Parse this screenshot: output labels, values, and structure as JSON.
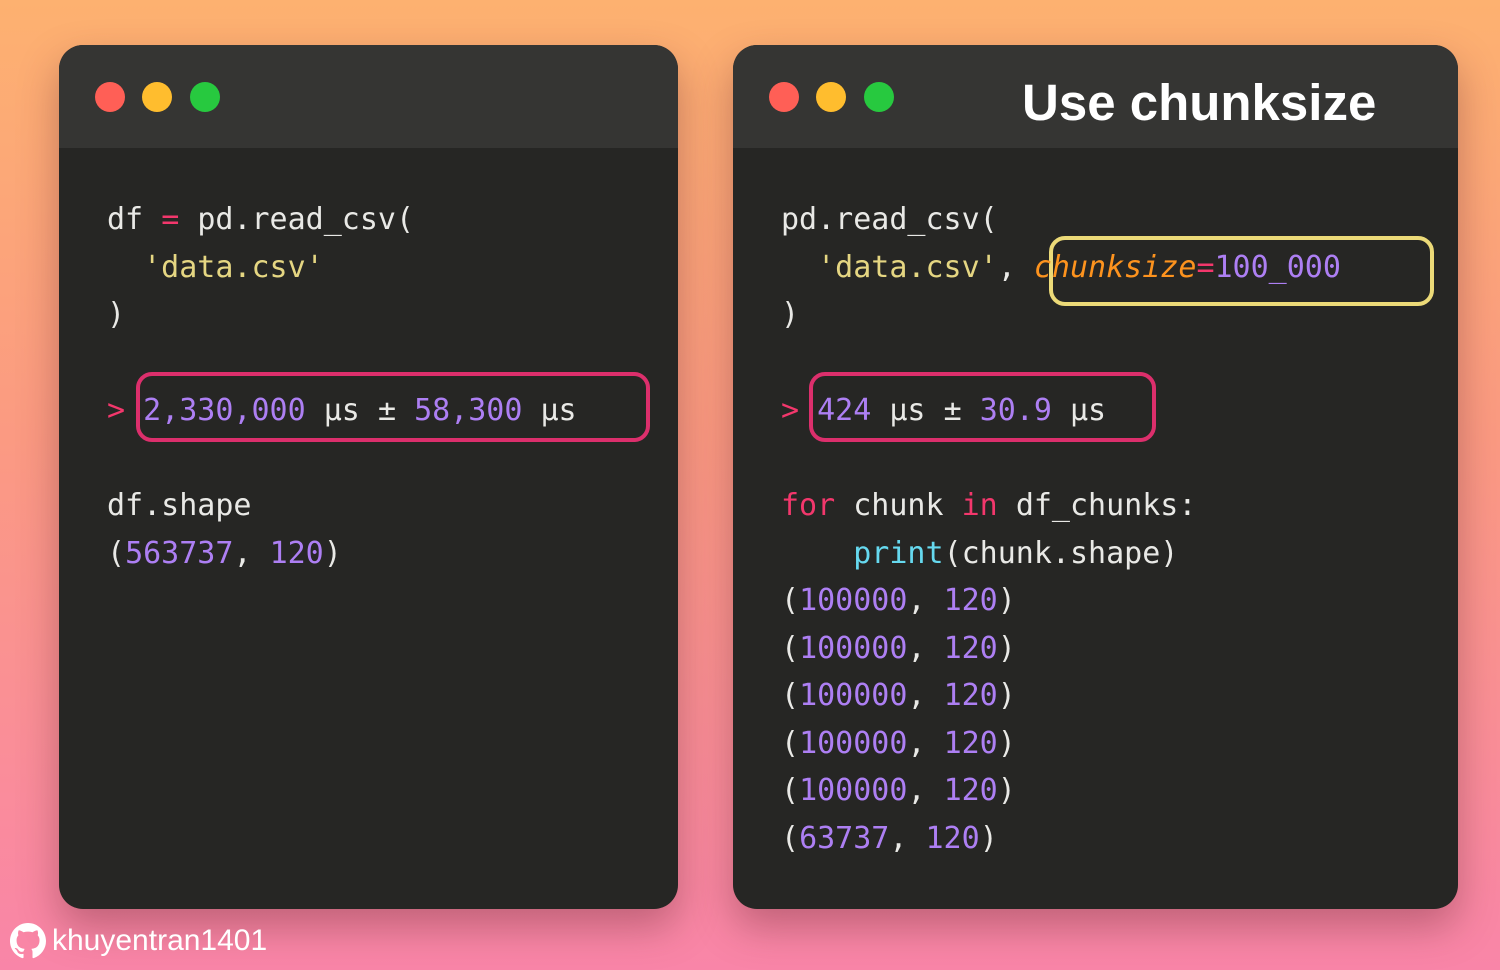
{
  "left_window": {
    "code": {
      "read_var": "df",
      "assign_op": "=",
      "read_call": "pd.read_csv(",
      "filename": "'data.csv'",
      "close_paren": ")",
      "prompt": ">",
      "timing": {
        "value": "2,330,000",
        "unit1": "µs",
        "pm": "±",
        "dev": "58,300",
        "unit2": "µs"
      },
      "shape_expr": "df.shape",
      "shape_result": {
        "open": "(",
        "rows": "563737",
        "sep": ",",
        "cols": "120",
        "close": ")"
      }
    }
  },
  "right_window": {
    "title": "Use chunksize",
    "code": {
      "read_call": "pd.read_csv(",
      "filename": "'data.csv'",
      "comma": ",",
      "param_name": "chunksize",
      "param_eq": "=",
      "param_value": "100_000",
      "close_paren": ")",
      "prompt": ">",
      "timing": {
        "value": "424",
        "unit1": "µs",
        "pm": "±",
        "dev": "30.9",
        "unit2": "µs"
      },
      "loop": {
        "for_kw": "for",
        "var": "chunk",
        "in_kw": "in",
        "iterable": "df_chunks:",
        "print_fn": "print",
        "print_args": "(chunk.shape)"
      },
      "chunk_shapes": [
        {
          "open": "(",
          "rows": "100000",
          "sep": ",",
          "cols": "120",
          "close": ")"
        },
        {
          "open": "(",
          "rows": "100000",
          "sep": ",",
          "cols": "120",
          "close": ")"
        },
        {
          "open": "(",
          "rows": "100000",
          "sep": ",",
          "cols": "120",
          "close": ")"
        },
        {
          "open": "(",
          "rows": "100000",
          "sep": ",",
          "cols": "120",
          "close": ")"
        },
        {
          "open": "(",
          "rows": "100000",
          "sep": ",",
          "cols": "120",
          "close": ")"
        },
        {
          "open": "(",
          "rows": "63737",
          "sep": ",",
          "cols": "120",
          "close": ")"
        }
      ]
    }
  },
  "footer": {
    "icon": "github-icon",
    "username": "khuyentran1401"
  },
  "colors": {
    "keyword": "#f3376c",
    "number": "#ad7ff3",
    "string": "#e5d682",
    "param": "#fd931e",
    "function": "#66d9ef",
    "timing_highlight": "#dc2f6c",
    "param_highlight": "#ecda78"
  }
}
